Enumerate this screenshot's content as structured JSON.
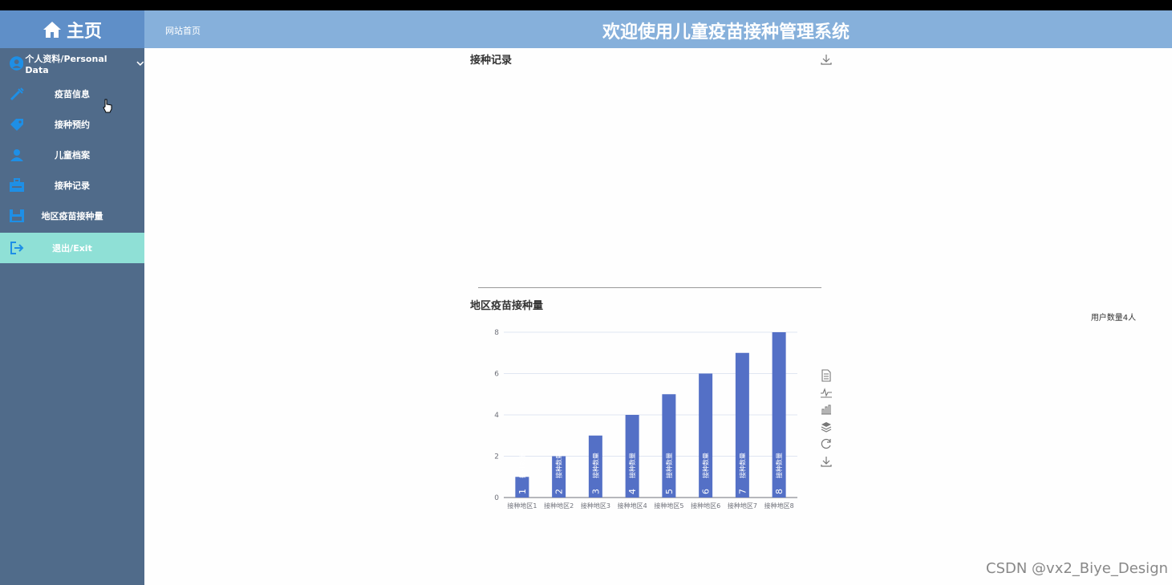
{
  "header": {
    "home_label": "主页",
    "site_link": "网站首页",
    "system_title": "欢迎使用儿童疫苗接种管理系统"
  },
  "sidebar": {
    "profile_label": "个人资料/Personal Data",
    "items": [
      {
        "label": "疫苗信息",
        "icon": "syringe-icon"
      },
      {
        "label": "接种预约",
        "icon": "tag-icon"
      },
      {
        "label": "儿童档案",
        "icon": "person-card-icon"
      },
      {
        "label": "接种记录",
        "icon": "briefcase-icon"
      },
      {
        "label": "地区疫苗接种量",
        "icon": "save-icon"
      },
      {
        "label": "退出/Exit",
        "icon": "exit-icon"
      }
    ],
    "colors": {
      "bg": "#506b8a",
      "exit_bg": "#8fe0d6",
      "icon": "#1e8fe6"
    }
  },
  "sections": {
    "records_title": "接种记录",
    "region_title": "地区疫苗接种量",
    "user_count": "用户数量4人"
  },
  "chart_data": {
    "type": "bar",
    "categories": [
      "接种地区1",
      "接种地区2",
      "接种地区3",
      "接种地区4",
      "接种地区5",
      "接种地区6",
      "接种地区7",
      "接种地区8"
    ],
    "series": [
      {
        "name": "接种数量",
        "values": [
          1,
          2,
          3,
          4,
          5,
          6,
          7,
          8
        ]
      }
    ],
    "ylim": [
      0,
      8
    ],
    "yticks": [
      0,
      2,
      4,
      6,
      8
    ],
    "grid": true,
    "bar_color": "#5470c6",
    "data_label_text": "接种数量"
  },
  "toolbox": [
    "data-view-icon",
    "line-chart-icon",
    "bar-chart-icon",
    "stack-icon",
    "restore-icon",
    "download-icon"
  ],
  "watermark": "CSDN @vx2_Biye_Design"
}
